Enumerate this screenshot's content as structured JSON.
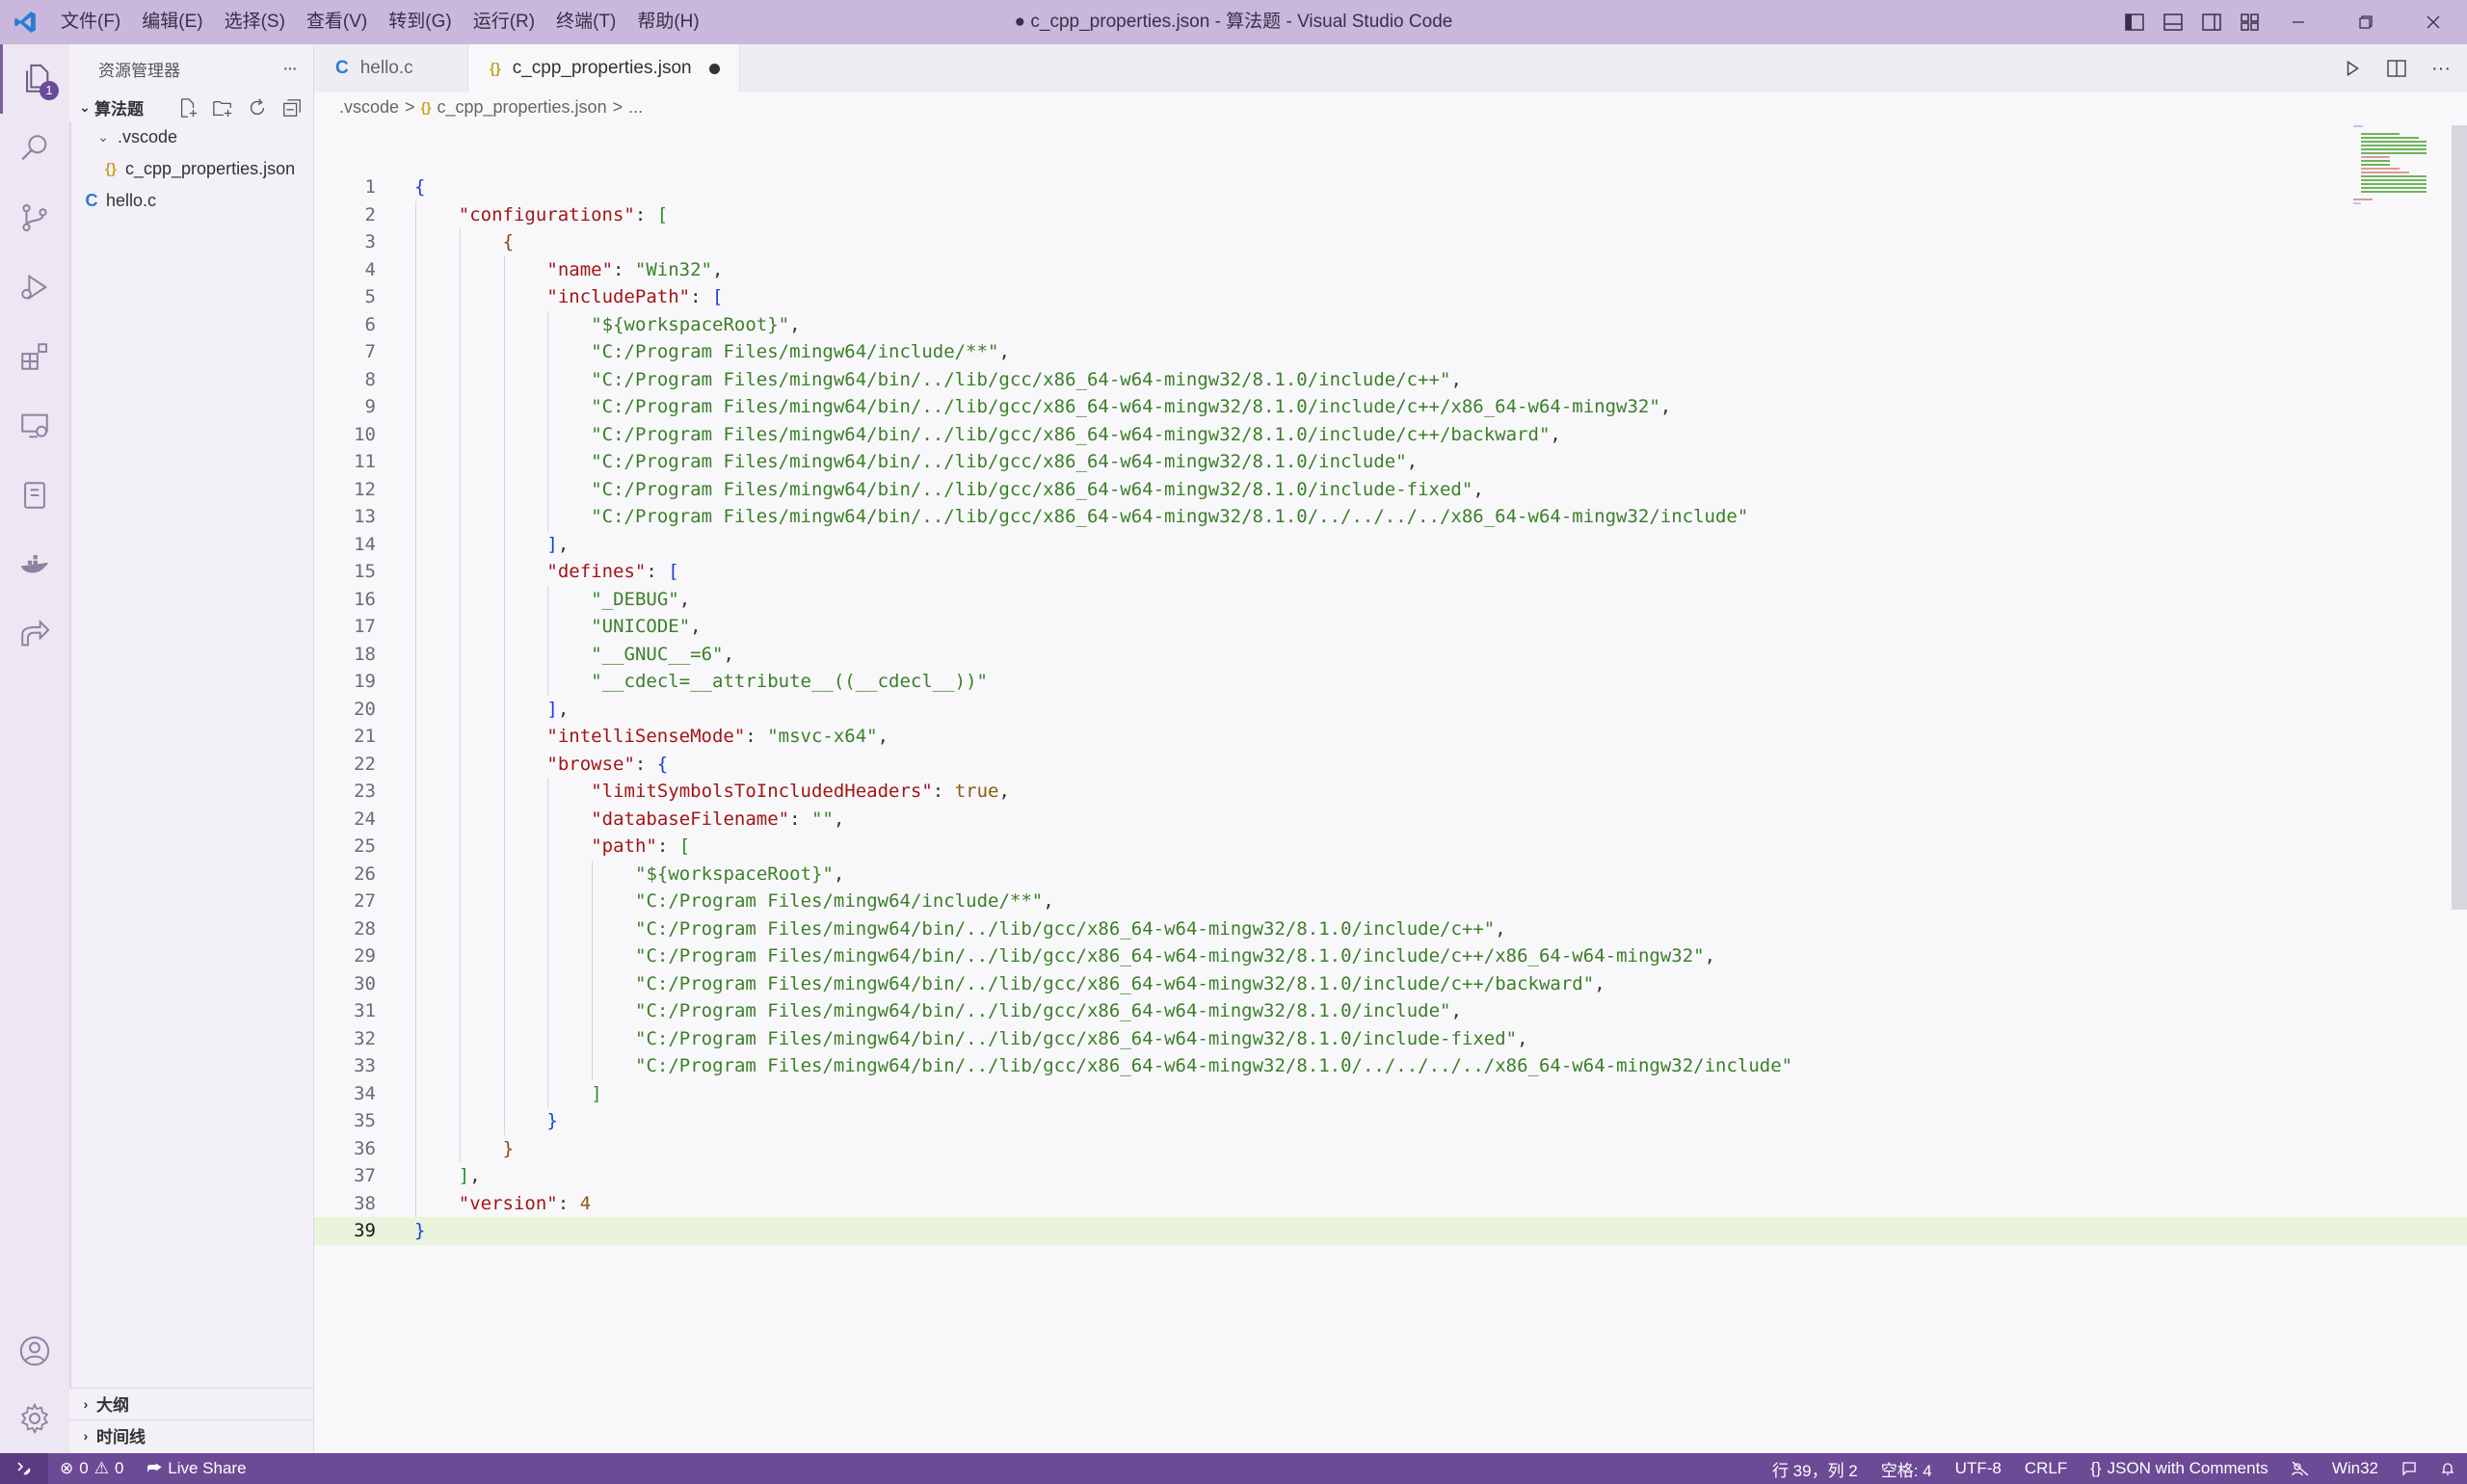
{
  "window": {
    "title": "● c_cpp_properties.json - 算法题 - Visual Studio Code"
  },
  "menu": [
    "文件(F)",
    "编辑(E)",
    "选择(S)",
    "查看(V)",
    "转到(G)",
    "运行(R)",
    "终端(T)",
    "帮助(H)"
  ],
  "activity": {
    "explorer_badge": "1"
  },
  "sidebar": {
    "title": "资源管理器",
    "more": "···",
    "folder_name": "算法题",
    "tree": [
      {
        "name": ".vscode",
        "type": "folder",
        "icon": "chevron-down-icon"
      },
      {
        "name": "c_cpp_properties.json",
        "type": "json",
        "icon_text": "{}"
      },
      {
        "name": "hello.c",
        "type": "c",
        "icon_text": "C"
      }
    ],
    "outline_label": "大纲",
    "timeline_label": "时间线"
  },
  "tabs": [
    {
      "label": "hello.c",
      "icon_text": "C",
      "active": false
    },
    {
      "label": "c_cpp_properties.json",
      "icon_text": "{}",
      "active": true,
      "dirty": true
    }
  ],
  "breadcrumb": [
    ".vscode",
    ">",
    "{}",
    "c_cpp_properties.json",
    ">",
    "..."
  ],
  "code_lines": [
    [
      [
        "b1",
        "{"
      ]
    ],
    [
      [
        "k",
        "\"configurations\""
      ],
      [
        "p",
        ": "
      ],
      [
        "b2",
        "["
      ]
    ],
    [
      [
        "b3",
        "{"
      ]
    ],
    [
      [
        "k",
        "\"name\""
      ],
      [
        "p",
        ": "
      ],
      [
        "s",
        "\"Win32\""
      ],
      [
        "p",
        ","
      ]
    ],
    [
      [
        "k",
        "\"includePath\""
      ],
      [
        "p",
        ": "
      ],
      [
        "b1",
        "["
      ]
    ],
    [
      [
        "s",
        "\"${workspaceRoot}\""
      ],
      [
        "p",
        ","
      ]
    ],
    [
      [
        "s",
        "\"C:/Program Files/mingw64/include/**\""
      ],
      [
        "p",
        ","
      ]
    ],
    [
      [
        "s",
        "\"C:/Program Files/mingw64/bin/../lib/gcc/x86_64-w64-mingw32/8.1.0/include/c++\""
      ],
      [
        "p",
        ","
      ]
    ],
    [
      [
        "s",
        "\"C:/Program Files/mingw64/bin/../lib/gcc/x86_64-w64-mingw32/8.1.0/include/c++/x86_64-w64-mingw32\""
      ],
      [
        "p",
        ","
      ]
    ],
    [
      [
        "s",
        "\"C:/Program Files/mingw64/bin/../lib/gcc/x86_64-w64-mingw32/8.1.0/include/c++/backward\""
      ],
      [
        "p",
        ","
      ]
    ],
    [
      [
        "s",
        "\"C:/Program Files/mingw64/bin/../lib/gcc/x86_64-w64-mingw32/8.1.0/include\""
      ],
      [
        "p",
        ","
      ]
    ],
    [
      [
        "s",
        "\"C:/Program Files/mingw64/bin/../lib/gcc/x86_64-w64-mingw32/8.1.0/include-fixed\""
      ],
      [
        "p",
        ","
      ]
    ],
    [
      [
        "s",
        "\"C:/Program Files/mingw64/bin/../lib/gcc/x86_64-w64-mingw32/8.1.0/../../../../x86_64-w64-mingw32/include\""
      ]
    ],
    [
      [
        "b1",
        "]"
      ],
      [
        "p",
        ","
      ]
    ],
    [
      [
        "k",
        "\"defines\""
      ],
      [
        "p",
        ": "
      ],
      [
        "b1",
        "["
      ]
    ],
    [
      [
        "s",
        "\"_DEBUG\""
      ],
      [
        "p",
        ","
      ]
    ],
    [
      [
        "s",
        "\"UNICODE\""
      ],
      [
        "p",
        ","
      ]
    ],
    [
      [
        "s",
        "\"__GNUC__=6\""
      ],
      [
        "p",
        ","
      ]
    ],
    [
      [
        "s",
        "\"__cdecl=__attribute__((__cdecl__))\""
      ]
    ],
    [
      [
        "b1",
        "]"
      ],
      [
        "p",
        ","
      ]
    ],
    [
      [
        "k",
        "\"intelliSenseMode\""
      ],
      [
        "p",
        ": "
      ],
      [
        "s",
        "\"msvc-x64\""
      ],
      [
        "p",
        ","
      ]
    ],
    [
      [
        "k",
        "\"browse\""
      ],
      [
        "p",
        ": "
      ],
      [
        "b1",
        "{"
      ]
    ],
    [
      [
        "k",
        "\"limitSymbolsToIncludedHeaders\""
      ],
      [
        "p",
        ": "
      ],
      [
        "bool",
        "true"
      ],
      [
        "p",
        ","
      ]
    ],
    [
      [
        "k",
        "\"databaseFilename\""
      ],
      [
        "p",
        ": "
      ],
      [
        "s",
        "\"\""
      ],
      [
        "p",
        ","
      ]
    ],
    [
      [
        "k",
        "\"path\""
      ],
      [
        "p",
        ": "
      ],
      [
        "b2",
        "["
      ]
    ],
    [
      [
        "s",
        "\"${workspaceRoot}\""
      ],
      [
        "p",
        ","
      ]
    ],
    [
      [
        "s",
        "\"C:/Program Files/mingw64/include/**\""
      ],
      [
        "p",
        ","
      ]
    ],
    [
      [
        "s",
        "\"C:/Program Files/mingw64/bin/../lib/gcc/x86_64-w64-mingw32/8.1.0/include/c++\""
      ],
      [
        "p",
        ","
      ]
    ],
    [
      [
        "s",
        "\"C:/Program Files/mingw64/bin/../lib/gcc/x86_64-w64-mingw32/8.1.0/include/c++/x86_64-w64-mingw32\""
      ],
      [
        "p",
        ","
      ]
    ],
    [
      [
        "s",
        "\"C:/Program Files/mingw64/bin/../lib/gcc/x86_64-w64-mingw32/8.1.0/include/c++/backward\""
      ],
      [
        "p",
        ","
      ]
    ],
    [
      [
        "s",
        "\"C:/Program Files/mingw64/bin/../lib/gcc/x86_64-w64-mingw32/8.1.0/include\""
      ],
      [
        "p",
        ","
      ]
    ],
    [
      [
        "s",
        "\"C:/Program Files/mingw64/bin/../lib/gcc/x86_64-w64-mingw32/8.1.0/include-fixed\""
      ],
      [
        "p",
        ","
      ]
    ],
    [
      [
        "s",
        "\"C:/Program Files/mingw64/bin/../lib/gcc/x86_64-w64-mingw32/8.1.0/../../../../x86_64-w64-mingw32/include\""
      ]
    ],
    [
      [
        "b2",
        "]"
      ]
    ],
    [
      [
        "b1",
        "}"
      ]
    ],
    [
      [
        "b3",
        "}"
      ]
    ],
    [
      [
        "b2",
        "]"
      ],
      [
        "p",
        ","
      ]
    ],
    [
      [
        "k",
        "\"version\""
      ],
      [
        "p",
        ": "
      ],
      [
        "num",
        "4"
      ]
    ],
    [
      [
        "b1",
        "}"
      ]
    ]
  ],
  "code_indents": [
    0,
    1,
    2,
    3,
    3,
    4,
    4,
    4,
    4,
    4,
    4,
    4,
    4,
    3,
    3,
    4,
    4,
    4,
    4,
    3,
    3,
    3,
    4,
    4,
    4,
    5,
    5,
    5,
    5,
    5,
    5,
    5,
    5,
    4,
    3,
    2,
    1,
    1,
    0
  ],
  "current_line": 39,
  "statusbar": {
    "errors": "0",
    "warnings": "0",
    "live_share": "Live Share",
    "position": "行 39，列 2",
    "spaces": "空格: 4",
    "encoding": "UTF-8",
    "eol": "CRLF",
    "language": "JSON with Comments",
    "config": "Win32"
  },
  "colors": {
    "titlebar": "#c9b8dc",
    "statusbar": "#6c4a96",
    "string": "#3c7f2a",
    "key": "#a31515"
  }
}
